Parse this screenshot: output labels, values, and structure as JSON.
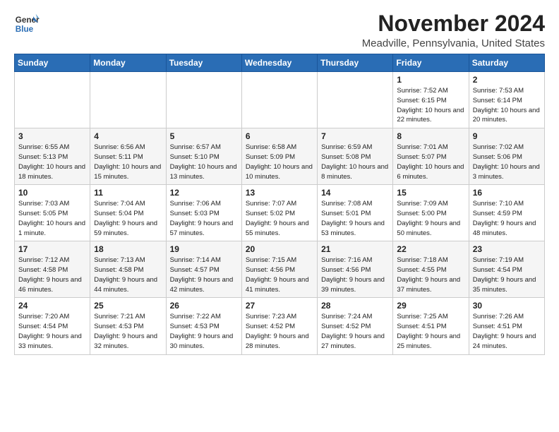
{
  "logo": {
    "general": "General",
    "blue": "Blue"
  },
  "header": {
    "month": "November 2024",
    "location": "Meadville, Pennsylvania, United States"
  },
  "weekdays": [
    "Sunday",
    "Monday",
    "Tuesday",
    "Wednesday",
    "Thursday",
    "Friday",
    "Saturday"
  ],
  "weeks": [
    [
      {
        "day": "",
        "info": ""
      },
      {
        "day": "",
        "info": ""
      },
      {
        "day": "",
        "info": ""
      },
      {
        "day": "",
        "info": ""
      },
      {
        "day": "",
        "info": ""
      },
      {
        "day": "1",
        "info": "Sunrise: 7:52 AM\nSunset: 6:15 PM\nDaylight: 10 hours and 22 minutes."
      },
      {
        "day": "2",
        "info": "Sunrise: 7:53 AM\nSunset: 6:14 PM\nDaylight: 10 hours and 20 minutes."
      }
    ],
    [
      {
        "day": "3",
        "info": "Sunrise: 6:55 AM\nSunset: 5:13 PM\nDaylight: 10 hours and 18 minutes."
      },
      {
        "day": "4",
        "info": "Sunrise: 6:56 AM\nSunset: 5:11 PM\nDaylight: 10 hours and 15 minutes."
      },
      {
        "day": "5",
        "info": "Sunrise: 6:57 AM\nSunset: 5:10 PM\nDaylight: 10 hours and 13 minutes."
      },
      {
        "day": "6",
        "info": "Sunrise: 6:58 AM\nSunset: 5:09 PM\nDaylight: 10 hours and 10 minutes."
      },
      {
        "day": "7",
        "info": "Sunrise: 6:59 AM\nSunset: 5:08 PM\nDaylight: 10 hours and 8 minutes."
      },
      {
        "day": "8",
        "info": "Sunrise: 7:01 AM\nSunset: 5:07 PM\nDaylight: 10 hours and 6 minutes."
      },
      {
        "day": "9",
        "info": "Sunrise: 7:02 AM\nSunset: 5:06 PM\nDaylight: 10 hours and 3 minutes."
      }
    ],
    [
      {
        "day": "10",
        "info": "Sunrise: 7:03 AM\nSunset: 5:05 PM\nDaylight: 10 hours and 1 minute."
      },
      {
        "day": "11",
        "info": "Sunrise: 7:04 AM\nSunset: 5:04 PM\nDaylight: 9 hours and 59 minutes."
      },
      {
        "day": "12",
        "info": "Sunrise: 7:06 AM\nSunset: 5:03 PM\nDaylight: 9 hours and 57 minutes."
      },
      {
        "day": "13",
        "info": "Sunrise: 7:07 AM\nSunset: 5:02 PM\nDaylight: 9 hours and 55 minutes."
      },
      {
        "day": "14",
        "info": "Sunrise: 7:08 AM\nSunset: 5:01 PM\nDaylight: 9 hours and 53 minutes."
      },
      {
        "day": "15",
        "info": "Sunrise: 7:09 AM\nSunset: 5:00 PM\nDaylight: 9 hours and 50 minutes."
      },
      {
        "day": "16",
        "info": "Sunrise: 7:10 AM\nSunset: 4:59 PM\nDaylight: 9 hours and 48 minutes."
      }
    ],
    [
      {
        "day": "17",
        "info": "Sunrise: 7:12 AM\nSunset: 4:58 PM\nDaylight: 9 hours and 46 minutes."
      },
      {
        "day": "18",
        "info": "Sunrise: 7:13 AM\nSunset: 4:58 PM\nDaylight: 9 hours and 44 minutes."
      },
      {
        "day": "19",
        "info": "Sunrise: 7:14 AM\nSunset: 4:57 PM\nDaylight: 9 hours and 42 minutes."
      },
      {
        "day": "20",
        "info": "Sunrise: 7:15 AM\nSunset: 4:56 PM\nDaylight: 9 hours and 41 minutes."
      },
      {
        "day": "21",
        "info": "Sunrise: 7:16 AM\nSunset: 4:56 PM\nDaylight: 9 hours and 39 minutes."
      },
      {
        "day": "22",
        "info": "Sunrise: 7:18 AM\nSunset: 4:55 PM\nDaylight: 9 hours and 37 minutes."
      },
      {
        "day": "23",
        "info": "Sunrise: 7:19 AM\nSunset: 4:54 PM\nDaylight: 9 hours and 35 minutes."
      }
    ],
    [
      {
        "day": "24",
        "info": "Sunrise: 7:20 AM\nSunset: 4:54 PM\nDaylight: 9 hours and 33 minutes."
      },
      {
        "day": "25",
        "info": "Sunrise: 7:21 AM\nSunset: 4:53 PM\nDaylight: 9 hours and 32 minutes."
      },
      {
        "day": "26",
        "info": "Sunrise: 7:22 AM\nSunset: 4:53 PM\nDaylight: 9 hours and 30 minutes."
      },
      {
        "day": "27",
        "info": "Sunrise: 7:23 AM\nSunset: 4:52 PM\nDaylight: 9 hours and 28 minutes."
      },
      {
        "day": "28",
        "info": "Sunrise: 7:24 AM\nSunset: 4:52 PM\nDaylight: 9 hours and 27 minutes."
      },
      {
        "day": "29",
        "info": "Sunrise: 7:25 AM\nSunset: 4:51 PM\nDaylight: 9 hours and 25 minutes."
      },
      {
        "day": "30",
        "info": "Sunrise: 7:26 AM\nSunset: 4:51 PM\nDaylight: 9 hours and 24 minutes."
      }
    ]
  ]
}
